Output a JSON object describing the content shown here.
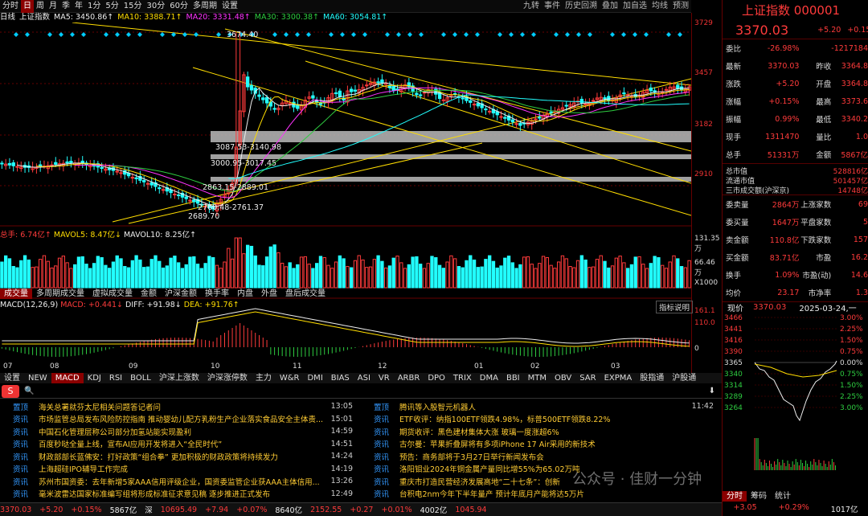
{
  "toolbar": {
    "periods": [
      "分时",
      "日",
      "周",
      "月",
      "季",
      "年",
      "1分",
      "5分",
      "15分",
      "30分",
      "60分",
      "多周期",
      "设置"
    ],
    "active_period": "日",
    "right": [
      "九转",
      "事件",
      "历史回溯",
      "叠加",
      "加自选",
      "均线",
      "预测"
    ]
  },
  "ma_legend": {
    "frame": "日线",
    "name": "上证指数",
    "ma5": "MA5: 3450.86↑",
    "ma10": "MA10: 3388.71↑",
    "ma20": "MA20: 3331.48↑",
    "ma30": "MA30: 3300.38↑",
    "ma60": "MA60: 3054.81↑"
  },
  "price_axis": [
    "3729",
    "3457",
    "3182",
    "2910"
  ],
  "annotations": {
    "high": "3674.40",
    "low": "2689.70",
    "zone1": "3087.53-3140.98",
    "zone2": "3000.95-3017.45",
    "zone3": "2863.15-2889.01",
    "zone4": "2760.48-2761.37"
  },
  "volume": {
    "legend_total": "总手: 6.74亿↑",
    "legend_mavol5": "MAVOL5: 8.47亿↓",
    "legend_mavol10": "MAVOL10: 8.25亿↑",
    "axis_top": "131.35万",
    "axis_mid": "66.46万",
    "axis_unit": "X1000",
    "tabs": [
      "成交量",
      "多周期成交量",
      "虚拟成交量",
      "金额",
      "沪深金额",
      "换手率",
      "内盘",
      "外盘",
      "盘后成交量"
    ]
  },
  "macd": {
    "title": "MACD(12,26,9)",
    "macd": "MACD: +0.441↓",
    "diff": "DIFF: +91.98↓",
    "dea": "DEA: +91.76↑",
    "button": "指标说明",
    "axis": [
      "161.1",
      "110.0",
      "0"
    ],
    "months": [
      "07",
      "08",
      "09",
      "10",
      "11",
      "12",
      "01",
      "02",
      "03"
    ]
  },
  "indicator_tabs": [
    "设置",
    "NEW",
    "MACD",
    "KDJ",
    "RSI",
    "BOLL",
    "沪深上涨数",
    "沪深涨停数",
    "主力",
    "W&R",
    "DMI",
    "BIAS",
    "ASI",
    "VR",
    "ARBR",
    "DPO",
    "TRIX",
    "DMA",
    "BBI",
    "MTM",
    "OBV",
    "SAR",
    "EXPMA",
    "股指通",
    "沪股通"
  ],
  "news": {
    "left": [
      {
        "tag": "置顶",
        "title": "海关总署就芬太尼相关问题答记者问",
        "time": "13:05"
      },
      {
        "tag": "资讯",
        "title": "市场监管总局发布风险防控指南 推动婴幼儿配方乳粉生产企业落实食品安全主体责...",
        "time": "15:01"
      },
      {
        "tag": "资讯",
        "title": "中国石化管理层称公司部分加氢站能实现盈利",
        "time": "14:59"
      },
      {
        "tag": "资讯",
        "title": "百度秒哒全量上线，宣布AI应用开发将进入“全民时代”",
        "time": "14:51"
      },
      {
        "tag": "资讯",
        "title": "财政部部长蓝佛安：打好政策“组合拳” 更加积极的财政政策将持续发力",
        "time": "14:24"
      },
      {
        "tag": "资讯",
        "title": "上海超硅IPO辅导工作完成",
        "time": "14:19"
      },
      {
        "tag": "资讯",
        "title": "苏州市国资委：去年新增5家AAA信用评级企业，国资委监管企业获AAA主体信用...",
        "time": "13:26"
      },
      {
        "tag": "资讯",
        "title": "毫米波雷达国家标准编写组将形成标准征求意见稿 逐步推进正式发布",
        "time": "12:49"
      }
    ],
    "right": [
      {
        "tag": "置顶",
        "title": "腾讯等入股智元机器人",
        "time": "11:42"
      },
      {
        "tag": "资讯",
        "title": "ETF收评：纳指100ETF领跌4.98%，标普500ETF领跌8.22%",
        "time": ""
      },
      {
        "tag": "资讯",
        "title": "期货收评：黑色建材集体大涨 玻璃一度涨超6%",
        "time": ""
      },
      {
        "tag": "资讯",
        "title": "古尔曼：苹果折叠屏将有多项iPhone 17 Air采用的新技术",
        "time": ""
      },
      {
        "tag": "资讯",
        "title": "预告：商务部将于3月27日举行新闻发布会",
        "time": ""
      },
      {
        "tag": "资讯",
        "title": "洛阳钼业2024年铜金属产量同比增55%为65.02万吨",
        "time": ""
      },
      {
        "tag": "资讯",
        "title": "重庆市打造民营经济发展高地“二十七条”：创新",
        "time": ""
      },
      {
        "tag": "资讯",
        "title": "台积电2nm今年下半年量产 预计年底月产能将达5万片",
        "time": ""
      }
    ]
  },
  "status": {
    "sh": "3370.03",
    "sh_chg": "+5.20",
    "sh_pct": "+0.15%",
    "sh_amt": "5867亿",
    "sz_label": "深",
    "sz": "10695.49",
    "sz_chg": "+7.94",
    "sz_pct": "+0.07%",
    "sz_amt": "8640亿",
    "cy": "2152.55",
    "cy_chg": "+0.27",
    "cy_pct": "+0.01%",
    "cy_amt": "4002亿",
    "x": "1045.94"
  },
  "side": {
    "name": "上证指数",
    "code": "000001",
    "price": "3370.03",
    "change": "+5.20",
    "pct": "+0.15%",
    "rows": [
      {
        "k": "委比",
        "v1": "-26.98%",
        "k2": "",
        "v2": "-1217184"
      },
      {
        "k": "最新",
        "v1": "3370.03",
        "k2": "昨收",
        "v2": "3364.8"
      },
      {
        "k": "涨跌",
        "v1": "+5.20",
        "k2": "开盘",
        "v2": "3364.8"
      },
      {
        "k": "涨幅",
        "v1": "+0.15%",
        "k2": "最高",
        "v2": "3373.6"
      },
      {
        "k": "振幅",
        "v1": "0.99%",
        "k2": "最低",
        "v2": "3340.2"
      },
      {
        "k": "现手",
        "v1": "1311470",
        "k2": "量比",
        "v2": "1.0"
      },
      {
        "k": "总手",
        "v1": "51331万",
        "k2": "金额",
        "v2": "5867亿"
      }
    ],
    "caps": [
      {
        "k": "总市值",
        "v": "528816亿"
      },
      {
        "k": "流通市值",
        "v": "501457亿"
      },
      {
        "k": "三市成交额(沪深京)",
        "v": "14748亿"
      }
    ],
    "rows2": [
      {
        "k": "委卖量",
        "v1": "2864万",
        "k2": "上涨家数",
        "v2": "69"
      },
      {
        "k": "委买量",
        "v1": "1647万",
        "k2": "平盘家数",
        "v2": "5"
      },
      {
        "k": "卖金额",
        "v1": "110.8亿",
        "k2": "下跌家数",
        "v2": "157"
      },
      {
        "k": "买金额",
        "v1": "83.71亿",
        "k2": "市盈",
        "v2": "16.2"
      },
      {
        "k": "换手",
        "v1": "1.09%",
        "k2": "市盈(动)",
        "v2": "14.6"
      },
      {
        "k": "均价",
        "v1": "23.17",
        "k2": "市净率",
        "v2": "1.3"
      }
    ],
    "now_label": "现价",
    "now_price": "3370.03",
    "now_date": "2025-03-24,一",
    "intraday_left": [
      "3466",
      "3441",
      "3416",
      "3390",
      "3365",
      "3340",
      "3314",
      "3289",
      "3264"
    ],
    "intraday_right": [
      "3.00%",
      "2.25%",
      "1.50%",
      "0.75%",
      "0.00%",
      "0.75%",
      "1.50%",
      "2.25%",
      "3.00%"
    ],
    "bottom_tabs": [
      "分时",
      "筹码",
      "统计"
    ],
    "bottom_status": [
      "+3.05",
      "+0.29%",
      "1017亿"
    ]
  },
  "watermark": "公众号 · 佳财一分钟"
}
